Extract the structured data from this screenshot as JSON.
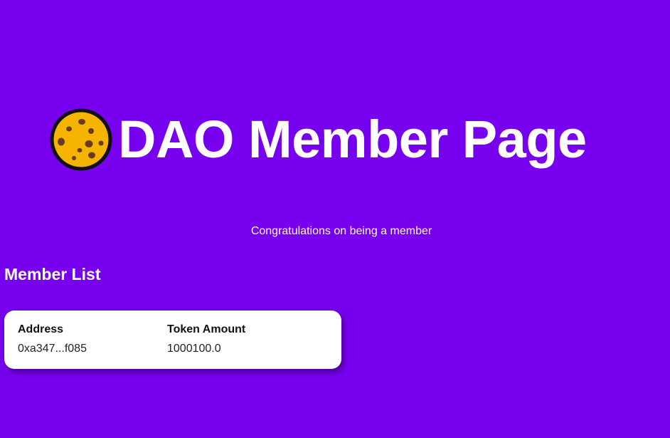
{
  "header": {
    "logo_icon": "cookie-icon",
    "title": "DAO Member Page"
  },
  "subtitle": "Congratulations on being a member",
  "member_list": {
    "title": "Member List",
    "columns": [
      "Address",
      "Token Amount"
    ],
    "rows": [
      [
        "0xa347...f085",
        "1000100.0"
      ]
    ]
  },
  "colors": {
    "background": "#7700ee",
    "card": "#ffffff",
    "cookie": "#f5b400",
    "chip": "#6b3a1e"
  }
}
